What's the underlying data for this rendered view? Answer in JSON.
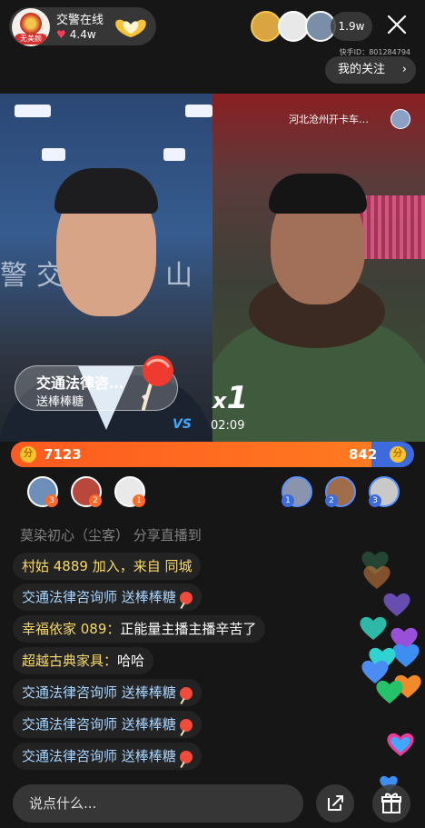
{
  "host": {
    "name": "交警在线",
    "likes": "4.4w",
    "avatar_tag": "无美颜"
  },
  "viewers": {
    "count": "1.9w"
  },
  "kuaishou_id": "快手ID：801284794",
  "my_follow_label": "我的关注",
  "guest": {
    "label": "河北沧州开卡车…"
  },
  "gift_banner": {
    "sender": "交通法律咨…",
    "gift": "送棒棒糖",
    "combo_prefix": "x",
    "combo_count": "1"
  },
  "pk": {
    "vs_label": "VS",
    "timer": "02:09",
    "left_score": "7123",
    "right_score": "842",
    "left_fraction": 0.894,
    "left_ranks": [
      "3",
      "2",
      "1"
    ],
    "right_ranks": [
      "1",
      "2",
      "3"
    ],
    "colors": {
      "left": "#ff5a1f",
      "right": "#3d6bdc"
    }
  },
  "chat": {
    "share_notice": "莫染初心（尘客） 分享直播到",
    "messages": [
      {
        "user": "村姑 4889 加入，来自 同城",
        "text": "",
        "user_color": "yellow",
        "gift": false
      },
      {
        "user": "交通法律咨询师",
        "text": "送棒棒糖",
        "user_color": "blue",
        "gift": true
      },
      {
        "user": "幸福依家 089：",
        "text": "正能量主播主播辛苦了",
        "user_color": "yellow",
        "gift": false
      },
      {
        "user": "超越古典家具：",
        "text": "哈哈",
        "user_color": "yellow",
        "gift": false
      },
      {
        "user": "交通法律咨询师",
        "text": "送棒棒糖",
        "user_color": "blue",
        "gift": true
      },
      {
        "user": "交通法律咨询师",
        "text": "送棒棒糖",
        "user_color": "blue",
        "gift": true
      },
      {
        "user": "交通法律咨询师",
        "text": "送棒棒糖",
        "user_color": "blue",
        "gift": true
      }
    ]
  },
  "input": {
    "placeholder": "说点什么..."
  },
  "icons": {
    "close": "close-icon",
    "heart": "heart-icon",
    "share": "share-icon",
    "gift": "gift-icon",
    "coin": "coin-icon"
  },
  "coin_glyph": "分",
  "wall_chars": [
    "警",
    "交",
    "山"
  ]
}
